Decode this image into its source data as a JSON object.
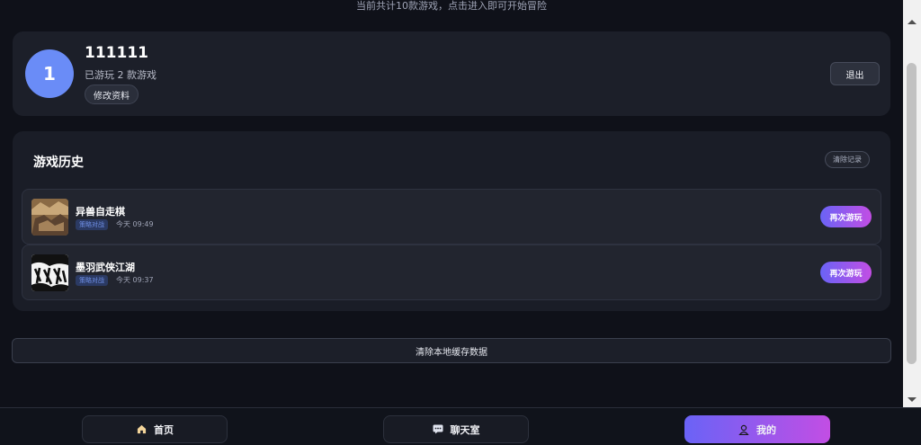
{
  "header": {
    "subtitle": "当前共计10款游戏，点击进入即可开始冒险"
  },
  "profile": {
    "avatar_text": "1",
    "username": "111111",
    "played_text": "已游玩 2 款游戏",
    "edit_label": "修改资料",
    "logout_label": "退出"
  },
  "history": {
    "title": "游戏历史",
    "clear_label": "清除记录",
    "items": [
      {
        "name": "异兽自走棋",
        "tag": "策略对战",
        "time": "今天 09:49",
        "action": "再次游玩"
      },
      {
        "name": "墨羽武侠江湖",
        "tag": "策略对战",
        "time": "今天 09:37",
        "action": "再次游玩"
      }
    ]
  },
  "clear_cache_label": "清除本地缓存数据",
  "nav": {
    "home": {
      "label": "首页",
      "icon": "home-icon"
    },
    "chat": {
      "label": "聊天室",
      "icon": "chat-icon"
    },
    "me": {
      "label": "我的",
      "icon": "user-icon"
    }
  },
  "colors": {
    "accent_start": "#6a63f6",
    "accent_end": "#c24ee4",
    "avatar": "#6a8cf7"
  }
}
